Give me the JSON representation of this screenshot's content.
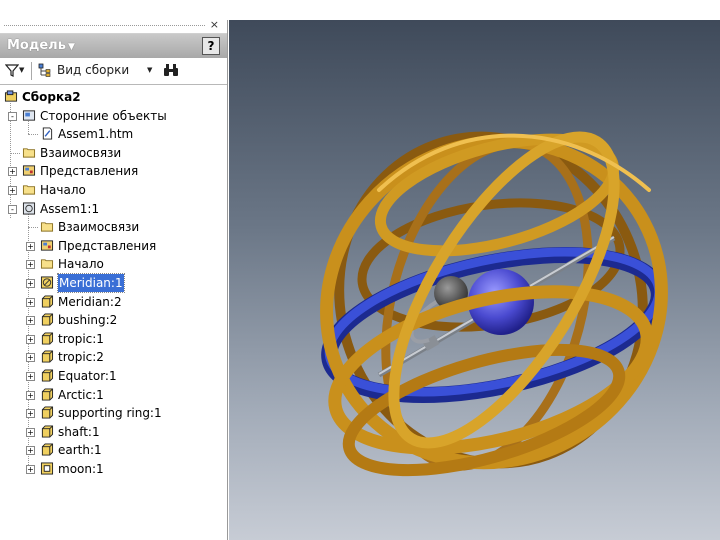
{
  "panel": {
    "title": "Модель",
    "close_glyph": "×",
    "help_glyph": "?",
    "toolbar": {
      "view_label": "Вид сборки",
      "filter_icon": "filter-icon",
      "find_icon": "binoculars-icon"
    }
  },
  "tree": [
    {
      "label": "Сборка2",
      "bold": true,
      "icon": "assembly-icon",
      "level": 0,
      "expander": ""
    },
    {
      "label": "Сторонние объекты",
      "icon": "third-party-icon",
      "level": 1,
      "expander": "-"
    },
    {
      "label": "Assem1.htm",
      "icon": "document-icon",
      "level": 2,
      "expander": ""
    },
    {
      "label": "Взаимосвязи",
      "icon": "folder-icon",
      "level": 1,
      "expander": ""
    },
    {
      "label": "Представления",
      "icon": "representations-icon",
      "level": 1,
      "expander": "+"
    },
    {
      "label": "Начало",
      "icon": "folder-icon",
      "level": 1,
      "expander": "+"
    },
    {
      "label": "Assem1:1",
      "icon": "subassembly-icon",
      "level": 1,
      "expander": "-"
    },
    {
      "label": "Взаимосвязи",
      "icon": "folder-icon",
      "level": 2,
      "expander": ""
    },
    {
      "label": "Представления",
      "icon": "representations-icon",
      "level": 2,
      "expander": "+"
    },
    {
      "label": "Начало",
      "icon": "folder-icon",
      "level": 2,
      "expander": "+"
    },
    {
      "label": "Meridian:1",
      "icon": "part-disabled-icon",
      "level": 2,
      "expander": "+",
      "selected": true
    },
    {
      "label": "Meridian:2",
      "icon": "part-icon",
      "level": 2,
      "expander": "+"
    },
    {
      "label": "bushing:2",
      "icon": "part-icon",
      "level": 2,
      "expander": "+"
    },
    {
      "label": "tropic:1",
      "icon": "part-icon",
      "level": 2,
      "expander": "+"
    },
    {
      "label": "tropic:2",
      "icon": "part-icon",
      "level": 2,
      "expander": "+"
    },
    {
      "label": "Equator:1",
      "icon": "part-icon",
      "level": 2,
      "expander": "+"
    },
    {
      "label": "Arctic:1",
      "icon": "part-icon",
      "level": 2,
      "expander": "+"
    },
    {
      "label": "supporting ring:1",
      "icon": "part-icon",
      "level": 2,
      "expander": "+"
    },
    {
      "label": "shaft:1",
      "icon": "part-icon",
      "level": 2,
      "expander": "+"
    },
    {
      "label": "earth:1",
      "icon": "part-icon",
      "level": 2,
      "expander": "+"
    },
    {
      "label": "moon:1",
      "icon": "subassembly-part-icon",
      "level": 2,
      "expander": "+"
    }
  ],
  "colors": {
    "ring_gold": "#c9901c",
    "ring_gold_dark": "#8a5a10",
    "equator_blue": "#2b3fc0",
    "sphere_blue": "#5050d8",
    "selection": "#3a6fd6"
  }
}
